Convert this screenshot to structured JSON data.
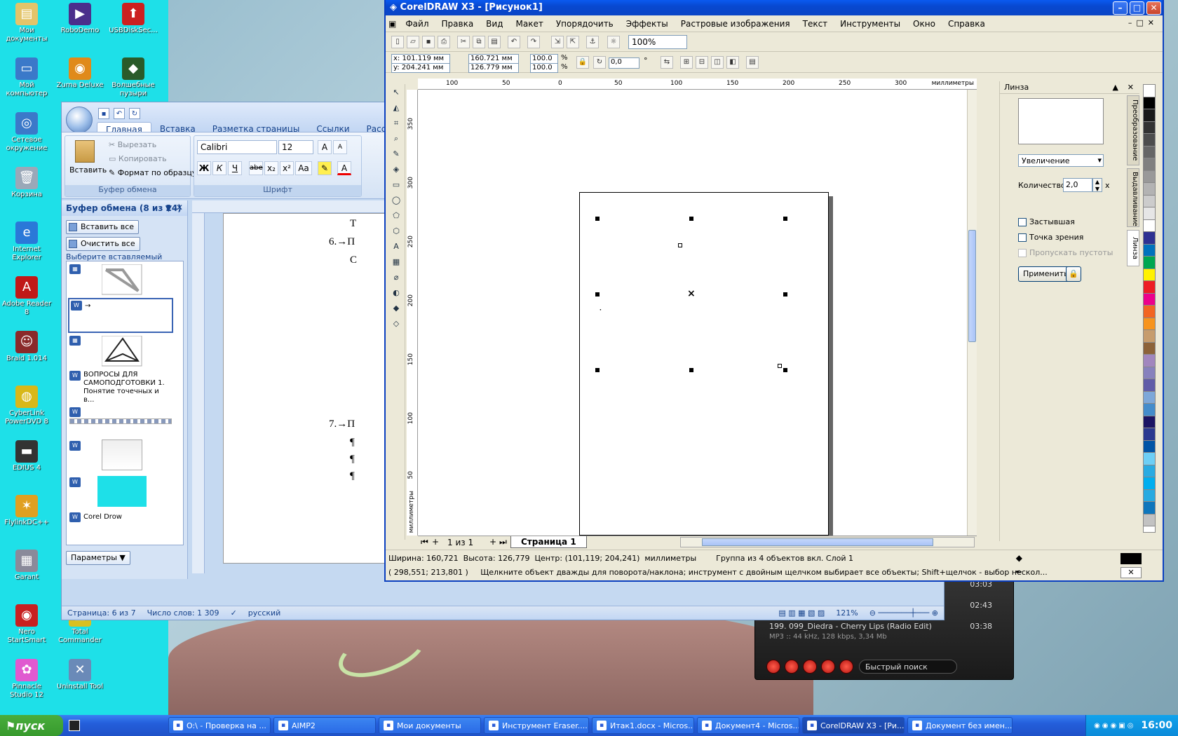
{
  "desktop": {
    "icons": [
      {
        "label": "Мои документы",
        "glyph": "▤",
        "color": "#e3c46a"
      },
      {
        "label": "RoboDemo",
        "glyph": "▶",
        "color": "#4b2f8c"
      },
      {
        "label": "USBDiskSec...",
        "glyph": "⬆",
        "color": "#cc2020"
      },
      {
        "label": "Мой компьютер",
        "glyph": "▭",
        "color": "#3b79c9"
      },
      {
        "label": "Zuma Deluxe",
        "glyph": "◉",
        "color": "#e08a1a"
      },
      {
        "label": "Волшебные пузыри",
        "glyph": "◆",
        "color": "#2a5b2a"
      },
      {
        "label": "Сетевое окружение",
        "glyph": "◎",
        "color": "#3b79c9"
      },
      {
        "label": "Корзина",
        "glyph": "🗑",
        "color": "#9aa8b8"
      },
      {
        "label": "Internet Explorer",
        "glyph": "e",
        "color": "#2a78d8"
      },
      {
        "label": "Adobe Reader 8",
        "glyph": "A",
        "color": "#c01818"
      },
      {
        "label": "Braid 1.014",
        "glyph": "☺",
        "color": "#8a2a2a"
      },
      {
        "label": "CyberLink PowerDVD 8",
        "glyph": "◍",
        "color": "#d8b818"
      },
      {
        "label": "EDIUS 4",
        "glyph": "▬",
        "color": "#333333"
      },
      {
        "label": "FlylinkDC++",
        "glyph": "✶",
        "color": "#e0a020"
      },
      {
        "label": "Garant",
        "glyph": "▦",
        "color": "#8a8a9a"
      },
      {
        "label": "Nero StartSmart",
        "glyph": "◉",
        "color": "#c82020"
      },
      {
        "label": "Total Commander",
        "glyph": "▣",
        "color": "#d8c020"
      },
      {
        "label": "Pinnacle Studio 12",
        "glyph": "✿",
        "color": "#e05ad0"
      },
      {
        "label": "Uninstall Tool",
        "glyph": "✕",
        "color": "#6a8ab8"
      }
    ]
  },
  "taskbar": {
    "start": "пуск",
    "items": [
      "O:\\ - Проверка на ...",
      "AIMP2",
      "Мои документы",
      "Инструмент Eraser....",
      "Итак1.docx - Micros...",
      "Документ4 - Micros...",
      "CorelDRAW X3 - [Ри...",
      "Документ без имен..."
    ],
    "clock": "16:00"
  },
  "word": {
    "tabs": [
      "Главная",
      "Вставка",
      "Разметка страницы",
      "Ссылки",
      "Рассылки"
    ],
    "clipboard_group": {
      "paste": "Вставить",
      "cut": "Вырезать",
      "copy": "Копировать",
      "format_painter": "Формат по образцу",
      "label": "Буфер обмена"
    },
    "font_group": {
      "font": "Calibri",
      "size": "12",
      "label": "Шрифт",
      "bold": "Ж",
      "italic": "К",
      "underline": "Ч",
      "strike": "abe",
      "sub": "x₂",
      "sup": "x²",
      "case": "Aa",
      "grow": "A",
      "shrink": "A"
    },
    "clip_pane": {
      "title": "Буфер обмена (8 из 24)",
      "paste_all": "Вставить все",
      "clear_all": "Очистить все",
      "hint": "Выберите вставляемый объект:",
      "item_arrow": "→",
      "item_text": "ВОПРОСЫ ДЛЯ САМОПОДГОТОВКИ 1. Понятие точечных и в...",
      "item_last": "Corel Drow",
      "options": "Параметры"
    },
    "doc_lines": [
      "Т",
      "6.→П",
      "С",
      "7.→П",
      "¶",
      "¶",
      "¶"
    ],
    "status": {
      "page": "Страница: 6 из 7",
      "words": "Число слов: 1 309",
      "lang": "русский",
      "zoom": "121%"
    }
  },
  "aimp": {
    "times": [
      "03:03",
      "02:43",
      "03:38"
    ],
    "track": "199. 099_Diedra - Cherry Lips (Radio Edit)",
    "info": "MP3 :: 44 kHz, 128 kbps, 3,34 Mb",
    "search": "Быстрый поиск"
  },
  "corel": {
    "title": "CorelDRAW X3 - [Рисунок1]",
    "menu": [
      "Файл",
      "Правка",
      "Вид",
      "Макет",
      "Упорядочить",
      "Эффекты",
      "Растровые изображения",
      "Текст",
      "Инструменты",
      "Окно",
      "Справка"
    ],
    "zoom": "100%",
    "props": {
      "x": "x: 101.119 мм",
      "y": "y: 204.241 мм",
      "w": "160.721 мм",
      "h": "126.779 мм",
      "sx": "100.0",
      "sy": "100.0",
      "pct": "%",
      "angle": "0,0",
      "deg": "°"
    },
    "hruler_ticks": [
      "100",
      "50",
      "0",
      "50",
      "100",
      "150",
      "200",
      "250",
      "300"
    ],
    "hruler_unit": "миллиметры",
    "vruler_ticks": [
      "350",
      "300",
      "250",
      "200",
      "150",
      "100",
      "50"
    ],
    "vruler_unit": "миллиметры",
    "pager": {
      "count": "1 из 1",
      "page": "Страница 1"
    },
    "status": {
      "line1": "Ширина: 160,721  Высота: 126,779  Центр: (101,119; 204,241)  миллиметры        Группа из 4 объектов вкл. Слой 1",
      "line2": "( 298,551; 213,801 )     Щелкните объект дважды для поворота/наклона; инструмент с двойным щелчком выбирает все объекты; Shift+щелчок - выбор нескол..."
    },
    "docker": {
      "title": "Линза",
      "mode": "Увеличение",
      "amount_label": "Количество:",
      "amount": "2,0",
      "x": "x",
      "frozen": "Застывшая",
      "viewpoint": "Точка зрения",
      "skip": "Пропускать пустоты",
      "apply": "Применить",
      "tabs": [
        "Преобразование",
        "Выдавливание",
        "Линза"
      ]
    },
    "palette": [
      "#ffffff",
      "#000000",
      "#1a1a1a",
      "#333333",
      "#4d4d4d",
      "#666666",
      "#808080",
      "#999999",
      "#b3b3b3",
      "#cccccc",
      "#e6e6e6",
      "#ffffff",
      "#2e3192",
      "#0072bc",
      "#00a651",
      "#fff200",
      "#ed1c24",
      "#ec008c",
      "#f26522",
      "#f7941d",
      "#c69c6d",
      "#8c6239",
      "#a186be",
      "#8781bd",
      "#605ca8",
      "#7da7d9",
      "#448ccb",
      "#1b1464",
      "#2b3990",
      "#0054a6",
      "#6dcff6",
      "#29abe2",
      "#00aeef",
      "#27aae1",
      "#0e76bc",
      "#c2c2c2"
    ]
  }
}
